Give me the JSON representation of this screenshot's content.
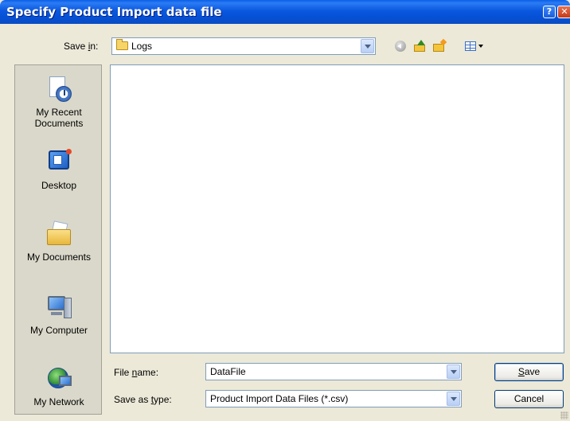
{
  "window": {
    "title": "Specify Product Import data file",
    "help_glyph": "?",
    "close_glyph": "✕"
  },
  "toolbar": {
    "save_in": {
      "label_pre": "Save ",
      "label_ul": "i",
      "label_post": "n:",
      "value": "Logs"
    },
    "icons": [
      "back-icon",
      "up-folder-icon",
      "new-folder-icon",
      "views-menu-icon"
    ]
  },
  "places": [
    {
      "label_line1": "My Recent",
      "label_line2": "Documents",
      "icon": "recent-documents-icon"
    },
    {
      "label_line1": "Desktop",
      "label_line2": "",
      "icon": "desktop-icon"
    },
    {
      "label_line1": "My Documents",
      "label_line2": "",
      "icon": "my-documents-icon"
    },
    {
      "label_line1": "My Computer",
      "label_line2": "",
      "icon": "my-computer-icon"
    },
    {
      "label_line1": "My Network",
      "label_line2": "",
      "icon": "my-network-icon"
    }
  ],
  "file_list": {
    "items": []
  },
  "file_name": {
    "label_pre": "File ",
    "label_ul": "n",
    "label_post": "ame:",
    "value": "DataFile"
  },
  "save_as_type": {
    "label_pre": "Save as ",
    "label_ul": "t",
    "label_post": "ype:",
    "value": "Product Import Data Files (*.csv)"
  },
  "buttons": {
    "save_ul": "S",
    "save_rest": "ave",
    "cancel": "Cancel"
  }
}
